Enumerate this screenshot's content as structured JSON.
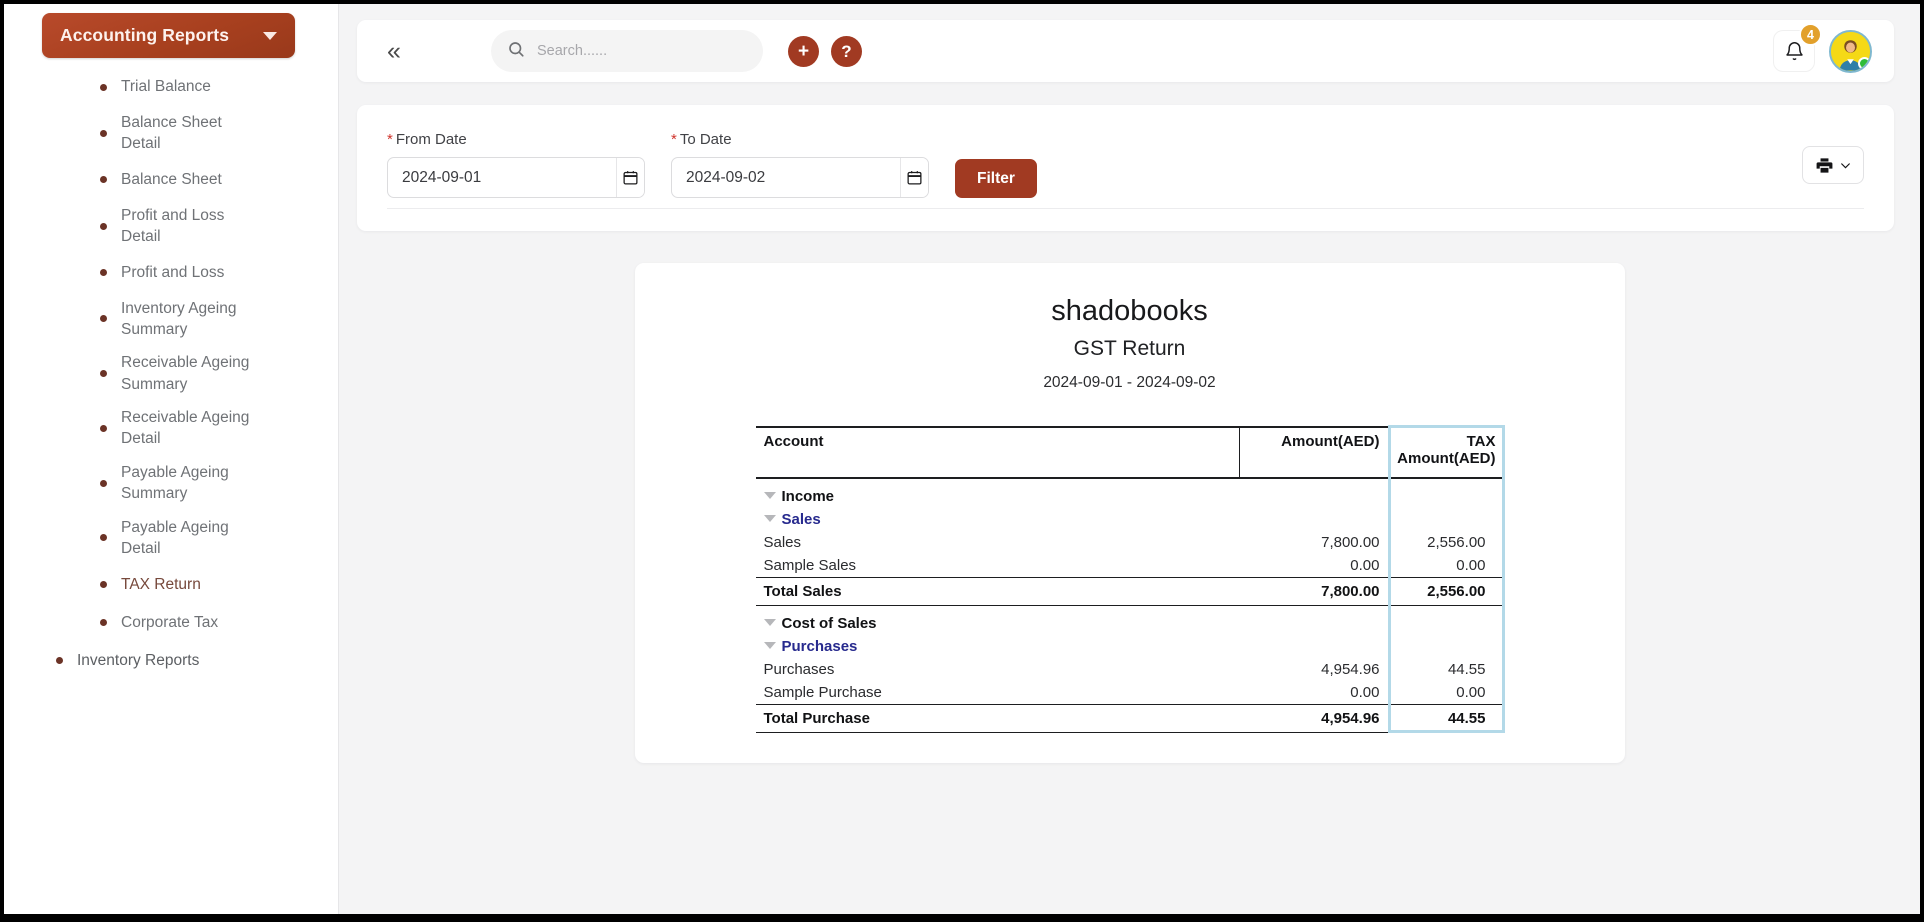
{
  "sidebar": {
    "header": {
      "label": "Accounting Reports",
      "icon": "chevron-down-icon"
    },
    "items": [
      {
        "label": "Trial Balance",
        "active": false,
        "top_level": false
      },
      {
        "label": "Balance Sheet Detail",
        "active": false,
        "top_level": false
      },
      {
        "label": "Balance Sheet",
        "active": false,
        "top_level": false
      },
      {
        "label": "Profit and Loss Detail",
        "active": false,
        "top_level": false
      },
      {
        "label": "Profit and Loss",
        "active": false,
        "top_level": false
      },
      {
        "label": "Inventory Ageing Summary",
        "active": false,
        "top_level": false
      },
      {
        "label": "Receivable Ageing Summary",
        "active": false,
        "top_level": false
      },
      {
        "label": "Receivable Ageing Detail",
        "active": false,
        "top_level": false
      },
      {
        "label": "Payable Ageing Summary",
        "active": false,
        "top_level": false
      },
      {
        "label": "Payable Ageing Detail",
        "active": false,
        "top_level": false
      },
      {
        "label": "TAX Return",
        "active": true,
        "top_level": false
      },
      {
        "label": "Corporate Tax",
        "active": false,
        "top_level": false
      },
      {
        "label": "Inventory Reports",
        "active": false,
        "top_level": true
      }
    ]
  },
  "topbar": {
    "collapse_icon": "«",
    "search": {
      "placeholder": "Search......",
      "value": "",
      "icon": "search-icon"
    },
    "add_button": {
      "label": "+",
      "icon": "plus-icon"
    },
    "help_button": {
      "label": "?",
      "icon": "question-icon"
    },
    "notification": {
      "count": "4",
      "icon": "bell-icon"
    },
    "avatar": {
      "icon": "avatar-icon",
      "status": "online"
    }
  },
  "filters": {
    "from_date": {
      "label": "To Date",
      "label_text": "From Date",
      "value": "2024-09-01",
      "required": "*",
      "icon": "calendar-icon"
    },
    "to_date": {
      "label_text": "To Date",
      "value": "2024-09-02",
      "required": "*",
      "icon": "calendar-icon"
    },
    "filter_button": "Filter",
    "print_button": {
      "icon": "printer-icon",
      "chevron": "chevron-down-icon"
    }
  },
  "report": {
    "company": "shadobooks",
    "title": "GST Return",
    "date_range": "2024-09-01 - 2024-09-02",
    "columns": {
      "account": "Account",
      "amount": "Amount(AED)",
      "tax_line1": "TAX",
      "tax_line2": "Amount(AED)"
    },
    "highlight_color": "#b3d9e8",
    "rows": [
      {
        "type": "group",
        "indent": 0,
        "toggle": true,
        "label": "Income",
        "amount": "",
        "tax": ""
      },
      {
        "type": "subgroup",
        "indent": 1,
        "toggle": true,
        "label": "Sales",
        "amount": "",
        "tax": ""
      },
      {
        "type": "item",
        "indent": 2,
        "toggle": false,
        "label": "Sales",
        "amount": "7,800.00",
        "tax": "2,556.00"
      },
      {
        "type": "item",
        "indent": 2,
        "toggle": false,
        "label": "Sample Sales",
        "amount": "0.00",
        "tax": "0.00"
      },
      {
        "type": "total",
        "indent": 0,
        "toggle": false,
        "label": "Total Sales",
        "amount": "7,800.00",
        "tax": "2,556.00"
      },
      {
        "type": "group",
        "indent": 0,
        "toggle": true,
        "label": "Cost of Sales",
        "amount": "",
        "tax": ""
      },
      {
        "type": "subgroup",
        "indent": 1,
        "toggle": true,
        "label": "Purchases",
        "amount": "",
        "tax": ""
      },
      {
        "type": "item",
        "indent": 2,
        "toggle": false,
        "label": "Purchases",
        "amount": "4,954.96",
        "tax": "44.55"
      },
      {
        "type": "item",
        "indent": 2,
        "toggle": false,
        "label": "Sample Purchase",
        "amount": "0.00",
        "tax": "0.00"
      },
      {
        "type": "total",
        "indent": 0,
        "toggle": false,
        "label": "Total Purchase",
        "amount": "4,954.96",
        "tax": "44.55"
      }
    ]
  },
  "theme": {
    "accent": "#a13a22",
    "sidebar_header_bg": "#b04a2b",
    "subgroup_color": "#272a8e",
    "badge_color": "#e2a02b",
    "online_color": "#2fbd3a"
  }
}
